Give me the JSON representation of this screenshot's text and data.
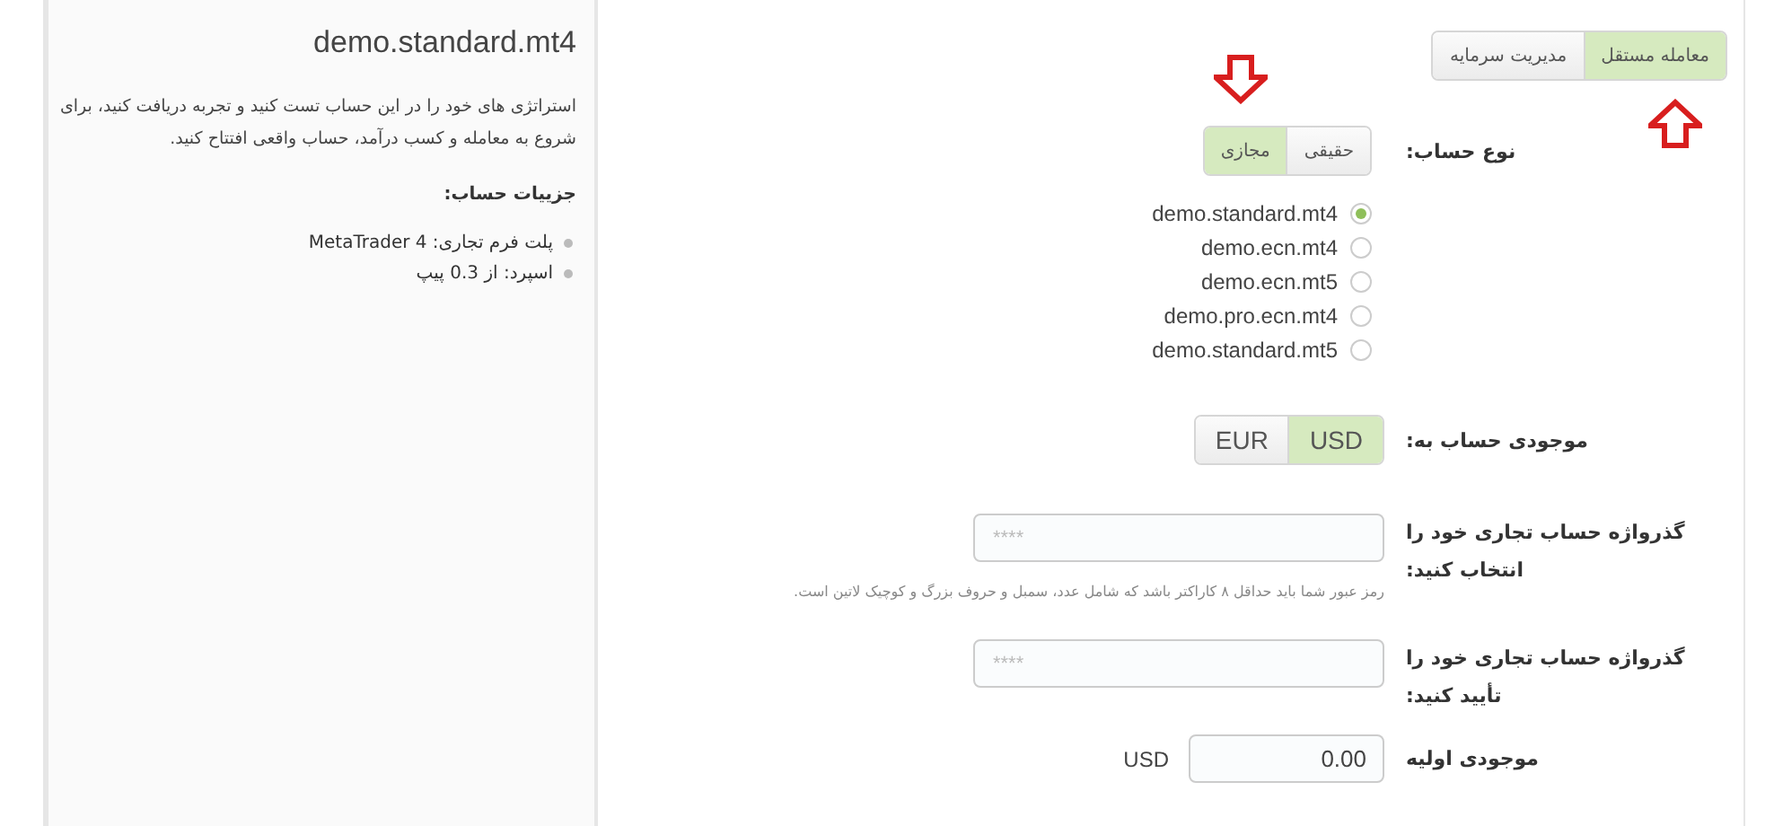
{
  "account_panel": {
    "title": "demo.standard.mt4",
    "description": "استراتژی های خود را در این حساب تست کنید و تجربه دریافت کنید، برای شروع به معامله و کسب درآمد، حساب واقعی افتتاح کنید.",
    "details_heading": "جزییات حساب:",
    "details": [
      "پلت فرم تجاری: MetaTrader 4",
      "اسپرد: از 0.3 پیپ"
    ]
  },
  "mode_tabs": [
    {
      "label": "معامله مستقل",
      "selected": true
    },
    {
      "label": "مدیریت سرمایه",
      "selected": false
    }
  ],
  "form": {
    "account_type": {
      "label": "نوع حساب:",
      "options": [
        {
          "label": "حقیقی",
          "selected": false
        },
        {
          "label": "مجازی",
          "selected": true
        }
      ]
    },
    "accounts": [
      {
        "label": "demo.standard.mt4",
        "selected": true
      },
      {
        "label": "demo.ecn.mt4",
        "selected": false
      },
      {
        "label": "demo.ecn.mt5",
        "selected": false
      },
      {
        "label": "demo.pro.ecn.mt4",
        "selected": false
      },
      {
        "label": "demo.standard.mt5",
        "selected": false
      }
    ],
    "currency": {
      "label": "موجودی حساب به:",
      "options": [
        {
          "label": "USD",
          "selected": true
        },
        {
          "label": "EUR",
          "selected": false
        }
      ]
    },
    "password": {
      "label": "گذرواژه حساب تجاری خود را انتخاب کنید:",
      "placeholder": "****",
      "hint": "رمز عبور شما باید حداقل ۸ کاراکتر باشد که شامل عدد، سمبل و حروف بزرگ و کوچیک لاتین است."
    },
    "confirm_password": {
      "label": "گذرواژه حساب تجاری خود را تأیید کنید:",
      "placeholder": "****"
    },
    "initial_balance": {
      "label": "موجودی اولیه",
      "value": "0.00",
      "unit": "USD"
    }
  }
}
